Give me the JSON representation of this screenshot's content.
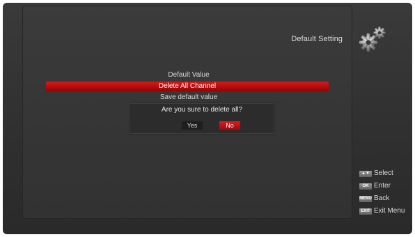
{
  "header": {
    "title": "Default Setting"
  },
  "menu": {
    "items": [
      {
        "label": "Default Value"
      },
      {
        "label": "Delete All Channel"
      },
      {
        "label": "Save default value"
      }
    ],
    "selected_index": 1
  },
  "dialog": {
    "message": "Are you sure to delete all?",
    "yes_label": "Yes",
    "no_label": "No",
    "focused": "No"
  },
  "legend": [
    {
      "key": "▲▼",
      "icon": "updown-key-icon",
      "label": "Select"
    },
    {
      "key": "OK",
      "icon": "ok-key-icon",
      "label": "Enter"
    },
    {
      "key": "MENU",
      "icon": "menu-key-icon",
      "label": "Back"
    },
    {
      "key": "EXIT",
      "icon": "exit-key-icon",
      "label": "Exit Menu"
    }
  ],
  "colors": {
    "highlight": "#c41212",
    "background": "#333333",
    "text": "#dcdcdc"
  }
}
